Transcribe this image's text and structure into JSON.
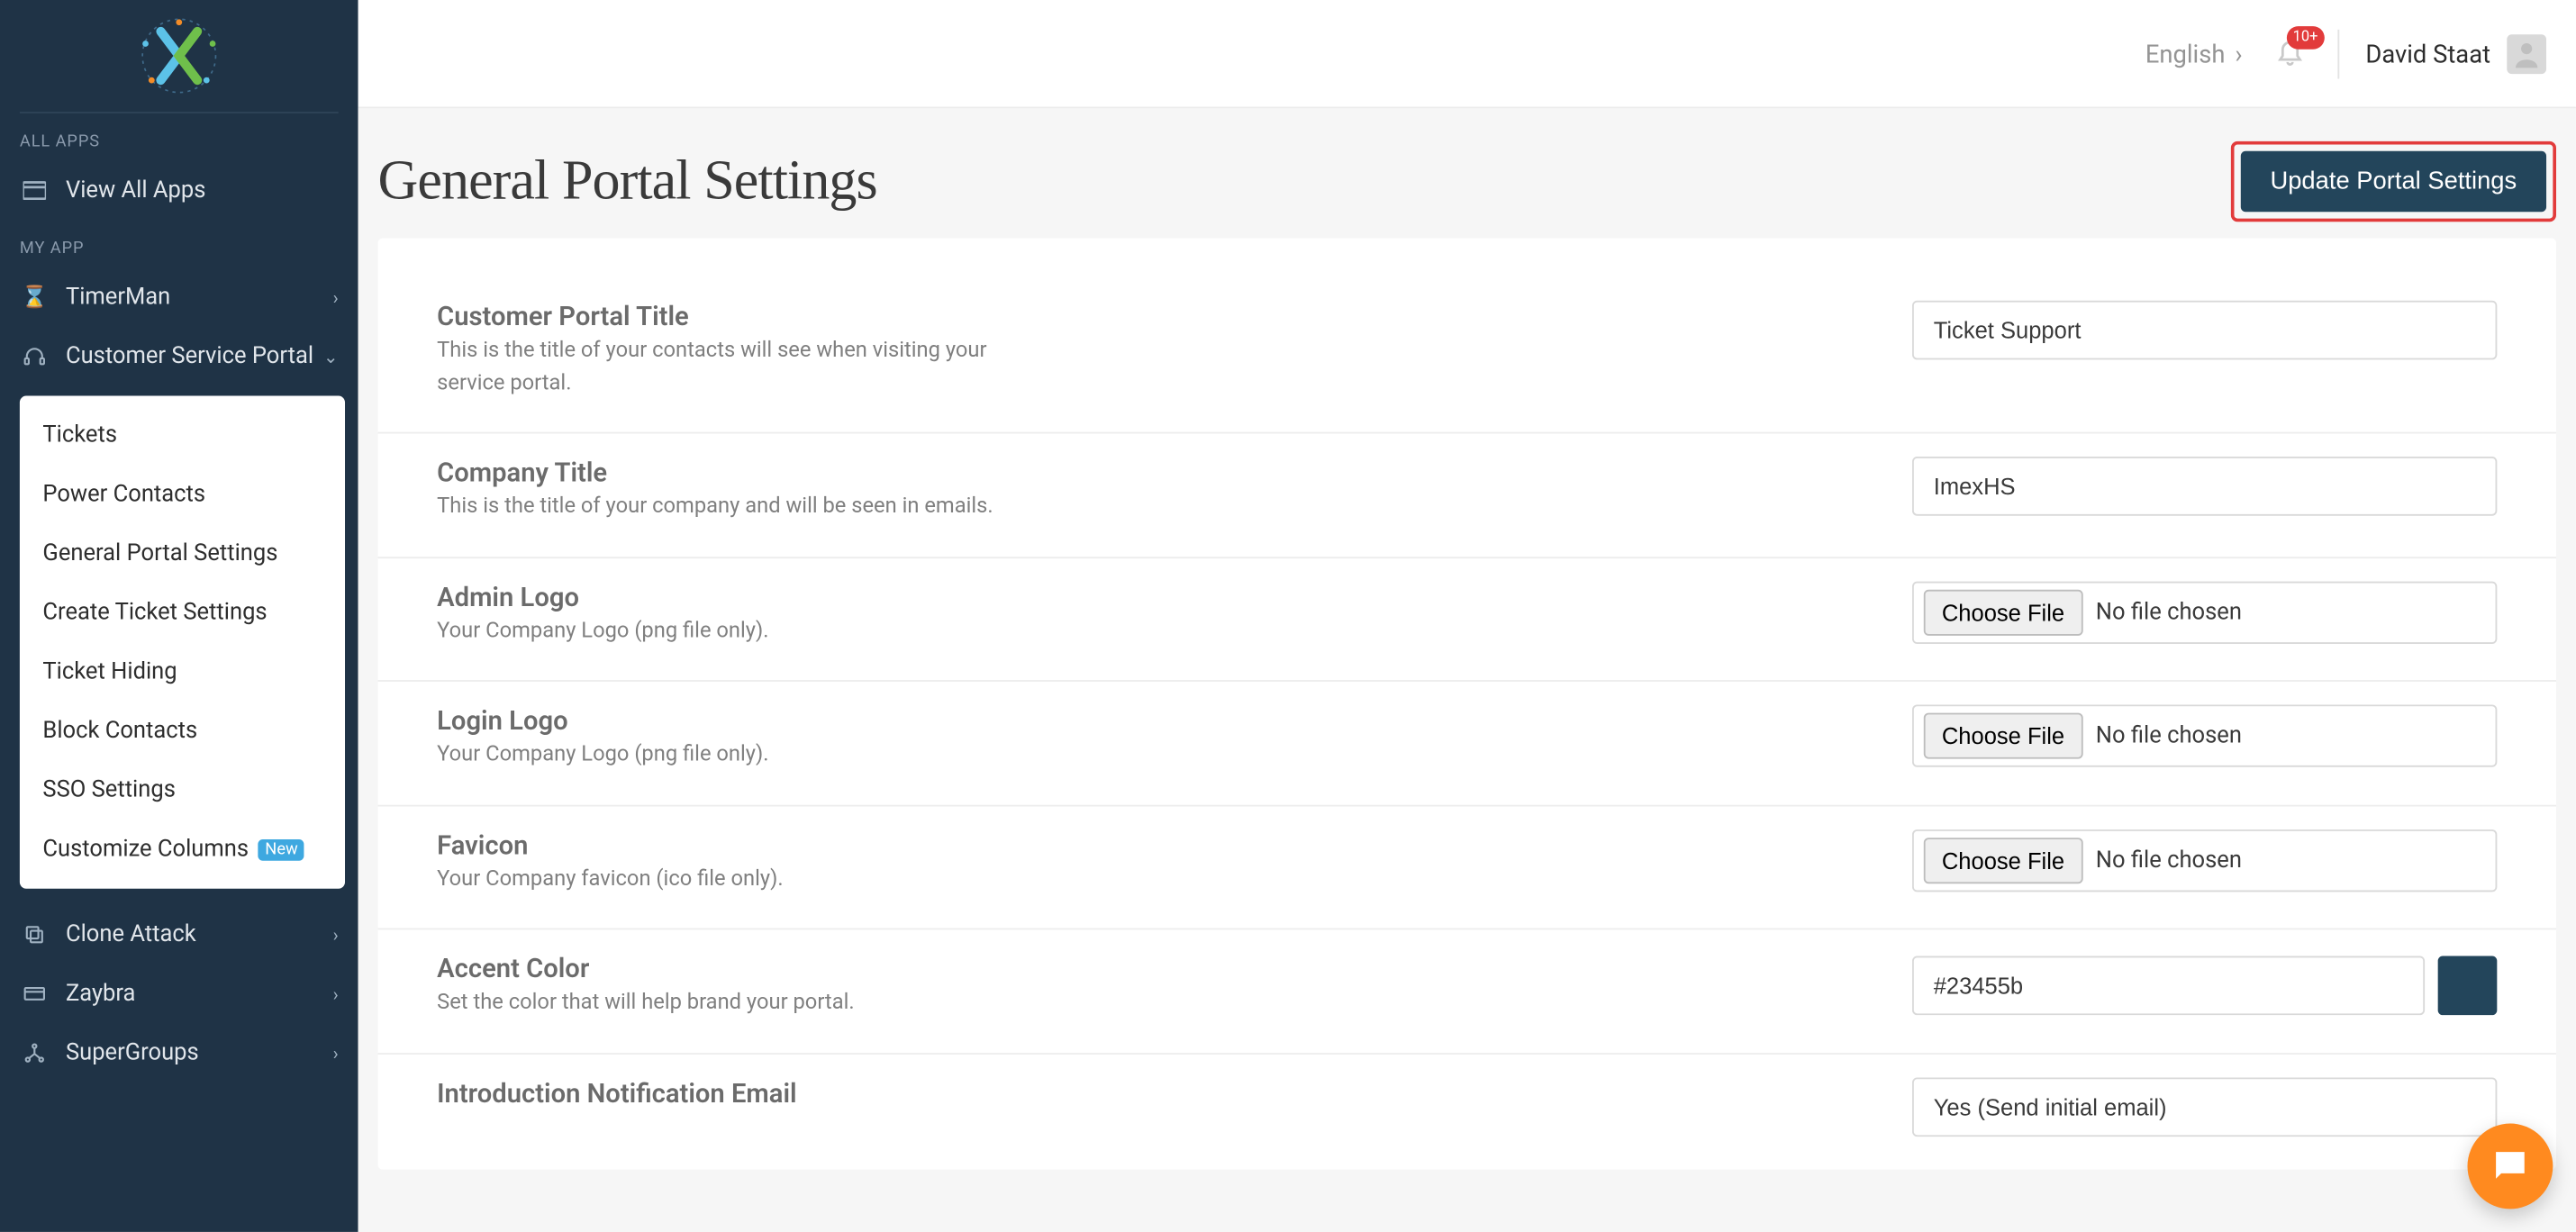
{
  "topbar": {
    "language": "English",
    "notifications_badge": "10+",
    "user_name": "David Staat"
  },
  "sidebar": {
    "all_apps_label": "ALL APPS",
    "view_all": "View All Apps",
    "my_app_label": "MY APP",
    "items": [
      {
        "label": "TimerMan"
      },
      {
        "label": "Customer Service Portal"
      },
      {
        "label": "Clone Attack"
      },
      {
        "label": "Zaybra"
      },
      {
        "label": "SuperGroups"
      }
    ],
    "submenu": [
      {
        "label": "Tickets"
      },
      {
        "label": "Power Contacts"
      },
      {
        "label": "General Portal Settings"
      },
      {
        "label": "Create Ticket Settings"
      },
      {
        "label": "Ticket Hiding"
      },
      {
        "label": "Block Contacts"
      },
      {
        "label": "SSO Settings"
      },
      {
        "label": "Customize Columns",
        "badge": "New"
      }
    ]
  },
  "page": {
    "title": "General Portal Settings",
    "update_button": "Update Portal Settings"
  },
  "form": {
    "choose_file": "Choose File",
    "no_file": "No file chosen",
    "rows": [
      {
        "label": "Customer Portal Title",
        "help": "This is the title of your contacts will see when visiting your service portal.",
        "value": "Ticket Support",
        "type": "text"
      },
      {
        "label": "Company Title",
        "help": "This is the title of your company and will be seen in emails.",
        "value": "ImexHS",
        "type": "text"
      },
      {
        "label": "Admin Logo",
        "help": "Your Company Logo (png file only).",
        "type": "file"
      },
      {
        "label": "Login Logo",
        "help": "Your Company Logo (png file only).",
        "type": "file"
      },
      {
        "label": "Favicon",
        "help": "Your Company favicon (ico file only).",
        "type": "file"
      },
      {
        "label": "Accent Color",
        "help": "Set the color that will help brand your portal.",
        "value": "#23455b",
        "type": "color"
      },
      {
        "label": "Introduction Notification Email",
        "help": "",
        "value": "Yes (Send initial email)",
        "type": "text"
      }
    ]
  },
  "accent_color": "#23455b"
}
